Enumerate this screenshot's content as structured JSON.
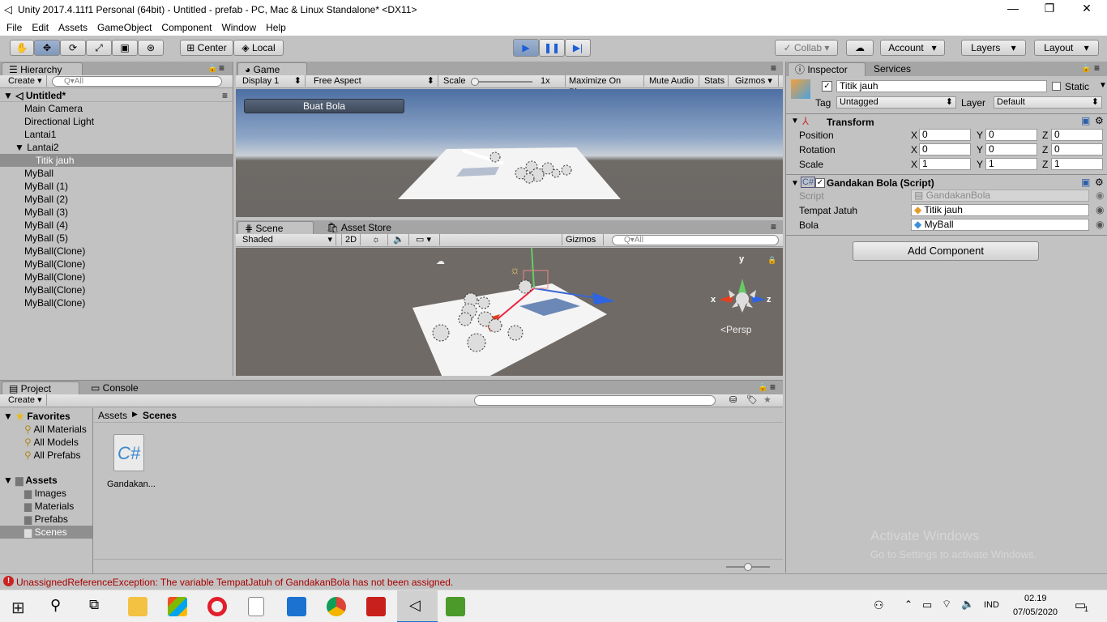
{
  "window": {
    "title": "Unity 2017.4.11f1 Personal (64bit) - Untitled - prefab - PC, Mac & Linux Standalone* <DX11>"
  },
  "menu": [
    "File",
    "Edit",
    "Assets",
    "GameObject",
    "Component",
    "Window",
    "Help"
  ],
  "toolbar": {
    "center": "Center",
    "local": "Local",
    "collab": "Collab",
    "account": "Account",
    "layers": "Layers",
    "layout": "Layout"
  },
  "hierarchy": {
    "tab": "Hierarchy",
    "create": "Create",
    "search_placeholder": "Q▾All",
    "scene": "Untitled*",
    "items": [
      {
        "label": "Main Camera"
      },
      {
        "label": "Directional Light"
      },
      {
        "label": "Lantai1"
      },
      {
        "label": "Lantai2"
      },
      {
        "label": "Titik jauh"
      },
      {
        "label": "MyBall"
      },
      {
        "label": "MyBall (1)"
      },
      {
        "label": "MyBall (2)"
      },
      {
        "label": "MyBall (3)"
      },
      {
        "label": "MyBall (4)"
      },
      {
        "label": "MyBall (5)"
      },
      {
        "label": "MyBall(Clone)"
      },
      {
        "label": "MyBall(Clone)"
      },
      {
        "label": "MyBall(Clone)"
      },
      {
        "label": "MyBall(Clone)"
      },
      {
        "label": "MyBall(Clone)"
      }
    ]
  },
  "game": {
    "tab": "Game",
    "display": "Display 1",
    "aspect": "Free Aspect",
    "scale_label": "Scale",
    "scale_value": "1x",
    "maximize": "Maximize On Play",
    "mute": "Mute Audio",
    "stats": "Stats",
    "gizmos": "Gizmos",
    "button": "Buat Bola"
  },
  "scene": {
    "tab": "Scene",
    "asset_store_tab": "Asset Store",
    "shaded": "Shaded",
    "mode2d": "2D",
    "gizmos": "Gizmos",
    "search_placeholder": "Q▾All",
    "persp": "Persp",
    "axis_x": "x",
    "axis_y": "y",
    "axis_z": "z"
  },
  "inspector": {
    "tab": "Inspector",
    "services_tab": "Services",
    "object_name": "Titik jauh",
    "static": "Static",
    "tag_label": "Tag",
    "tag_value": "Untagged",
    "layer_label": "Layer",
    "layer_value": "Default",
    "transform": {
      "title": "Transform",
      "position_label": "Position",
      "rotation_label": "Rotation",
      "scale_label": "Scale",
      "position": [
        "0",
        "0",
        "0"
      ],
      "rotation": [
        "0",
        "0",
        "0"
      ],
      "scale": [
        "1",
        "1",
        "1"
      ],
      "axes": [
        "X",
        "Y",
        "Z"
      ]
    },
    "script_component": {
      "title": "Gandakan Bola (Script)",
      "script_label": "Script",
      "script_value": "GandakanBola",
      "tempat_label": "Tempat Jatuh",
      "tempat_value": "Titik jauh",
      "bola_label": "Bola",
      "bola_value": "MyBall"
    },
    "add_component": "Add Component",
    "watermark_1": "Activate Windows",
    "watermark_2": "Go to Settings to activate Windows."
  },
  "project": {
    "tab": "Project",
    "console_tab": "Console",
    "create": "Create",
    "favorites_label": "Favorites",
    "favorites": [
      "All Materials",
      "All Models",
      "All Prefabs"
    ],
    "assets_label": "Assets",
    "folders": [
      "Images",
      "Materials",
      "Prefabs",
      "Scenes"
    ],
    "breadcrumb_root": "Assets",
    "breadcrumb_current": "Scenes",
    "file_name": "Gandakan..."
  },
  "status": {
    "error": "UnassignedReferenceException: The variable TempatJatuh of GandakanBola has not been assigned."
  },
  "taskbar": {
    "lang": "IND",
    "time": "02.19",
    "date": "07/05/2020",
    "notif": "1"
  }
}
